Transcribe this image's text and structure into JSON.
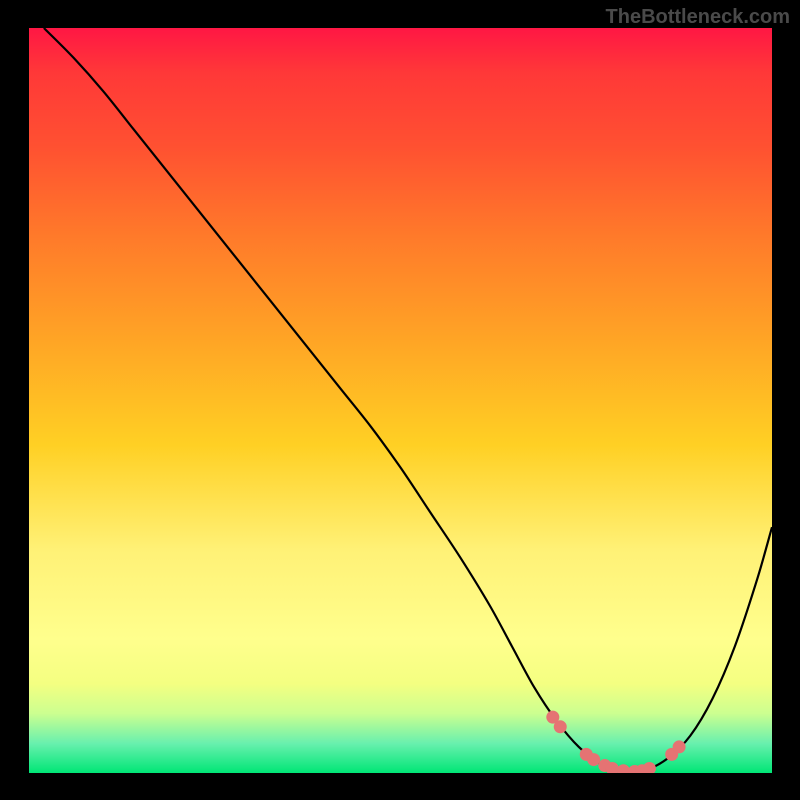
{
  "watermark": "TheBottleneck.com",
  "chart_data": {
    "type": "line",
    "title": "",
    "xlabel": "",
    "ylabel": "",
    "xlim": [
      0,
      100
    ],
    "ylim": [
      0,
      100
    ],
    "curve": {
      "name": "bottleneck-curve",
      "x": [
        2,
        6,
        10,
        14,
        18,
        22,
        26,
        30,
        34,
        38,
        42,
        46,
        50,
        54,
        58,
        62,
        65,
        68,
        71,
        74,
        77,
        80,
        83,
        86,
        89,
        92,
        95,
        98,
        100
      ],
      "y": [
        100,
        96,
        91.5,
        86.5,
        81.5,
        76.5,
        71.5,
        66.5,
        61.5,
        56.5,
        51.5,
        46.5,
        41,
        35,
        29,
        22.5,
        17,
        11.5,
        7,
        3.5,
        1.2,
        0.2,
        0.4,
        2,
        5,
        10,
        17,
        26,
        33
      ]
    },
    "markers": {
      "name": "highlight-dots",
      "color": "#e57373",
      "points": [
        {
          "x": 70.5,
          "y": 7.5
        },
        {
          "x": 71.5,
          "y": 6.2
        },
        {
          "x": 75.0,
          "y": 2.5
        },
        {
          "x": 76.0,
          "y": 1.8
        },
        {
          "x": 77.5,
          "y": 1.0
        },
        {
          "x": 78.5,
          "y": 0.6
        },
        {
          "x": 80.0,
          "y": 0.3
        },
        {
          "x": 81.5,
          "y": 0.2
        },
        {
          "x": 82.5,
          "y": 0.3
        },
        {
          "x": 83.5,
          "y": 0.6
        },
        {
          "x": 86.5,
          "y": 2.5
        },
        {
          "x": 87.5,
          "y": 3.5
        }
      ]
    }
  }
}
